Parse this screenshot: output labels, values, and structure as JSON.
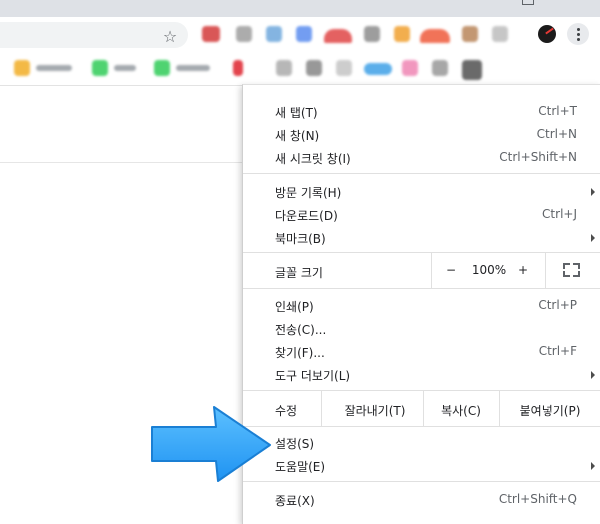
{
  "browser": {
    "accent_color": "#1a73e8",
    "icons": {
      "bookmark_star": "☆"
    }
  },
  "menu": {
    "group1": [
      {
        "label": "새 탭(T)",
        "shortcut": "Ctrl+T"
      },
      {
        "label": "새 창(N)",
        "shortcut": "Ctrl+N"
      },
      {
        "label": "새 시크릿 창(I)",
        "shortcut": "Ctrl+Shift+N"
      }
    ],
    "group2": [
      {
        "label": "방문 기록(H)",
        "submenu": true
      },
      {
        "label": "다운로드(D)",
        "shortcut": "Ctrl+J"
      },
      {
        "label": "북마크(B)",
        "submenu": true
      }
    ],
    "zoom": {
      "label": "글꼴 크기",
      "minus": "−",
      "value": "100%",
      "plus": "+",
      "fullscreen_icon": "fullscreen-icon"
    },
    "group3": [
      {
        "label": "인쇄(P)",
        "shortcut": "Ctrl+P"
      },
      {
        "label": "전송(C)...",
        "shortcut": ""
      },
      {
        "label": "찾기(F)...",
        "shortcut": "Ctrl+F"
      },
      {
        "label": "도구 더보기(L)",
        "submenu": true
      }
    ],
    "edit": {
      "label": "수정",
      "cut": "잘라내기(T)",
      "copy": "복사(C)",
      "paste": "붙여넣기(P)"
    },
    "group4": [
      {
        "label": "설정(S)",
        "highlighted_by_arrow": true
      },
      {
        "label": "도움말(E)",
        "submenu": true
      }
    ],
    "group5": [
      {
        "label": "종료(X)",
        "shortcut": "Ctrl+Shift+Q"
      }
    ]
  },
  "callout": {
    "arrow_color": "#2fa4ff",
    "points_to": "설정(S)"
  }
}
